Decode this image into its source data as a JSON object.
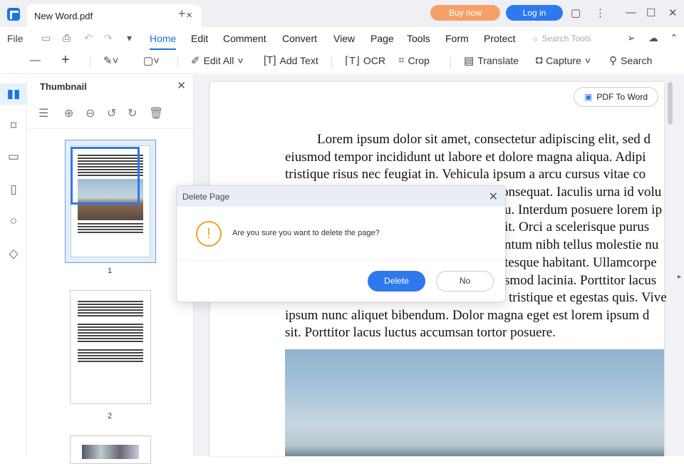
{
  "window": {
    "tab_title": "New  Word.pdf",
    "buy_now": "Buy now",
    "login": "Log in"
  },
  "menu": {
    "file": "File",
    "items": [
      "Home",
      "Edit",
      "Comment",
      "Convert",
      "View",
      "Page",
      "Tools",
      "Form",
      "Protect"
    ],
    "search_tools": "Search Tools"
  },
  "toolbar": {
    "edit_all": "Edit All",
    "add_text": "Add Text",
    "ocr": "OCR",
    "crop": "Crop",
    "translate": "Translate",
    "capture": "Capture",
    "search": "Search"
  },
  "thumbnail": {
    "title": "Thumbnail",
    "pages": [
      "1",
      "2"
    ]
  },
  "document": {
    "pdf_to_word": "PDF To Word",
    "lines": [
      "Lorem ipsum dolor sit amet, consectetur adipiscing elit, sed d",
      "eiusmod tempor incididunt ut labore et dolore magna aliqua. Adipi",
      "tristique risus nec feugiat in. Vehicula ipsum a arcu cursus vitae co",
      "onsequat. Iaculis urna id volu",
      "u. Interdum posuere lorem ip",
      "it. Orci a scelerisque purus",
      "ntum nibh tellus molestie nu",
      "tesque habitant. Ullamcorpe",
      "smod lacinia. Porttitor lacus",
      "tristique et egestas quis. Vive",
      "ipsum nunc aliquet bibendum. Dolor magna eget est lorem ipsum d",
      "sit. Porttitor lacus luctus accumsan tortor posuere."
    ]
  },
  "dialog": {
    "title": "Delete Page",
    "message": "Are you sure you want to delete the page?",
    "delete": "Delete",
    "no": "No"
  },
  "colors": {
    "accent": "#2f78ee",
    "warning": "#f0a020",
    "buy": "#f5a068"
  }
}
